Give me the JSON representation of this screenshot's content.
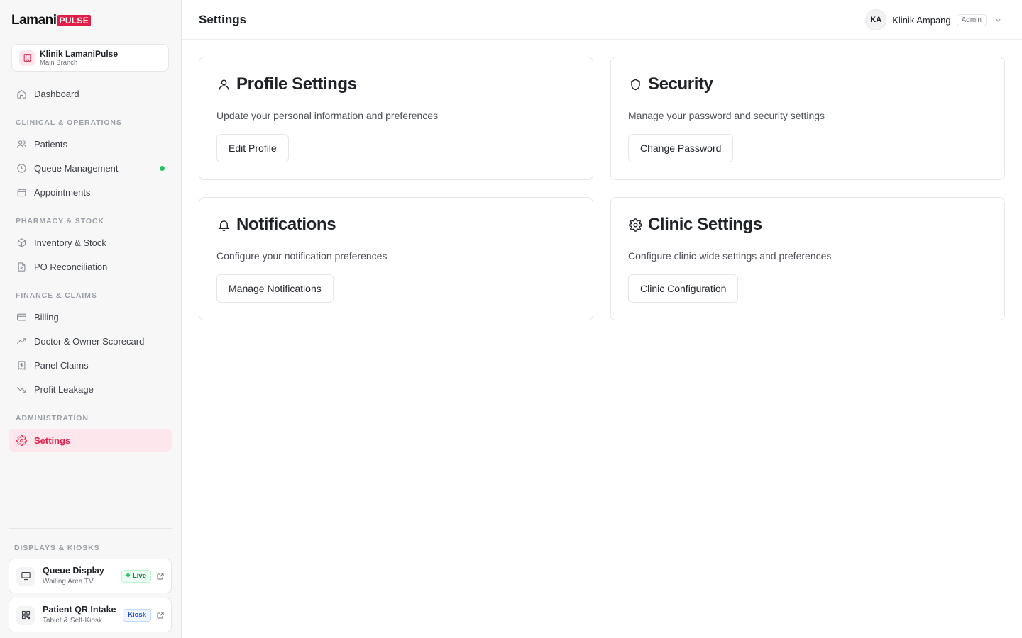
{
  "brand": {
    "word": "Lamani",
    "badge": "PULSE",
    "accent": "#e11d48"
  },
  "clinic": {
    "name": "Klinik LamaniPulse",
    "branch": "Main Branch",
    "icon": "building-icon"
  },
  "sidebar": {
    "dashboard": "Dashboard",
    "sections": {
      "clinical": "CLINICAL & OPERATIONS",
      "pharmacy": "PHARMACY & STOCK",
      "finance": "FINANCE & CLAIMS",
      "admin": "ADMINISTRATION",
      "displays": "DISPLAYS & KIOSKS"
    },
    "items": {
      "patients": "Patients",
      "queue": "Queue Management",
      "appointments": "Appointments",
      "inventory": "Inventory & Stock",
      "po": "PO Reconciliation",
      "billing": "Billing",
      "scorecard": "Doctor & Owner Scorecard",
      "panel_claims": "Panel Claims",
      "profit_leakage": "Profit Leakage",
      "settings": "Settings"
    },
    "kiosks": [
      {
        "title": "Queue Display",
        "subtitle": "Waiting Area TV",
        "tag": "Live"
      },
      {
        "title": "Patient QR Intake",
        "subtitle": "Tablet & Self-Kiosk",
        "tag": "Kiosk"
      }
    ]
  },
  "header": {
    "title": "Settings",
    "user": {
      "initials": "KA",
      "name": "Klinik Ampang",
      "role": "Admin"
    }
  },
  "cards": [
    {
      "title": "Profile Settings",
      "description": "Update your personal information and preferences",
      "button": "Edit Profile",
      "icon": "user-icon"
    },
    {
      "title": "Security",
      "description": "Manage your password and security settings",
      "button": "Change Password",
      "icon": "shield-icon"
    },
    {
      "title": "Notifications",
      "description": "Configure your notification preferences",
      "button": "Manage Notifications",
      "icon": "bell-icon"
    },
    {
      "title": "Clinic Settings",
      "description": "Configure clinic-wide settings and preferences",
      "button": "Clinic Configuration",
      "icon": "gear-icon"
    }
  ]
}
